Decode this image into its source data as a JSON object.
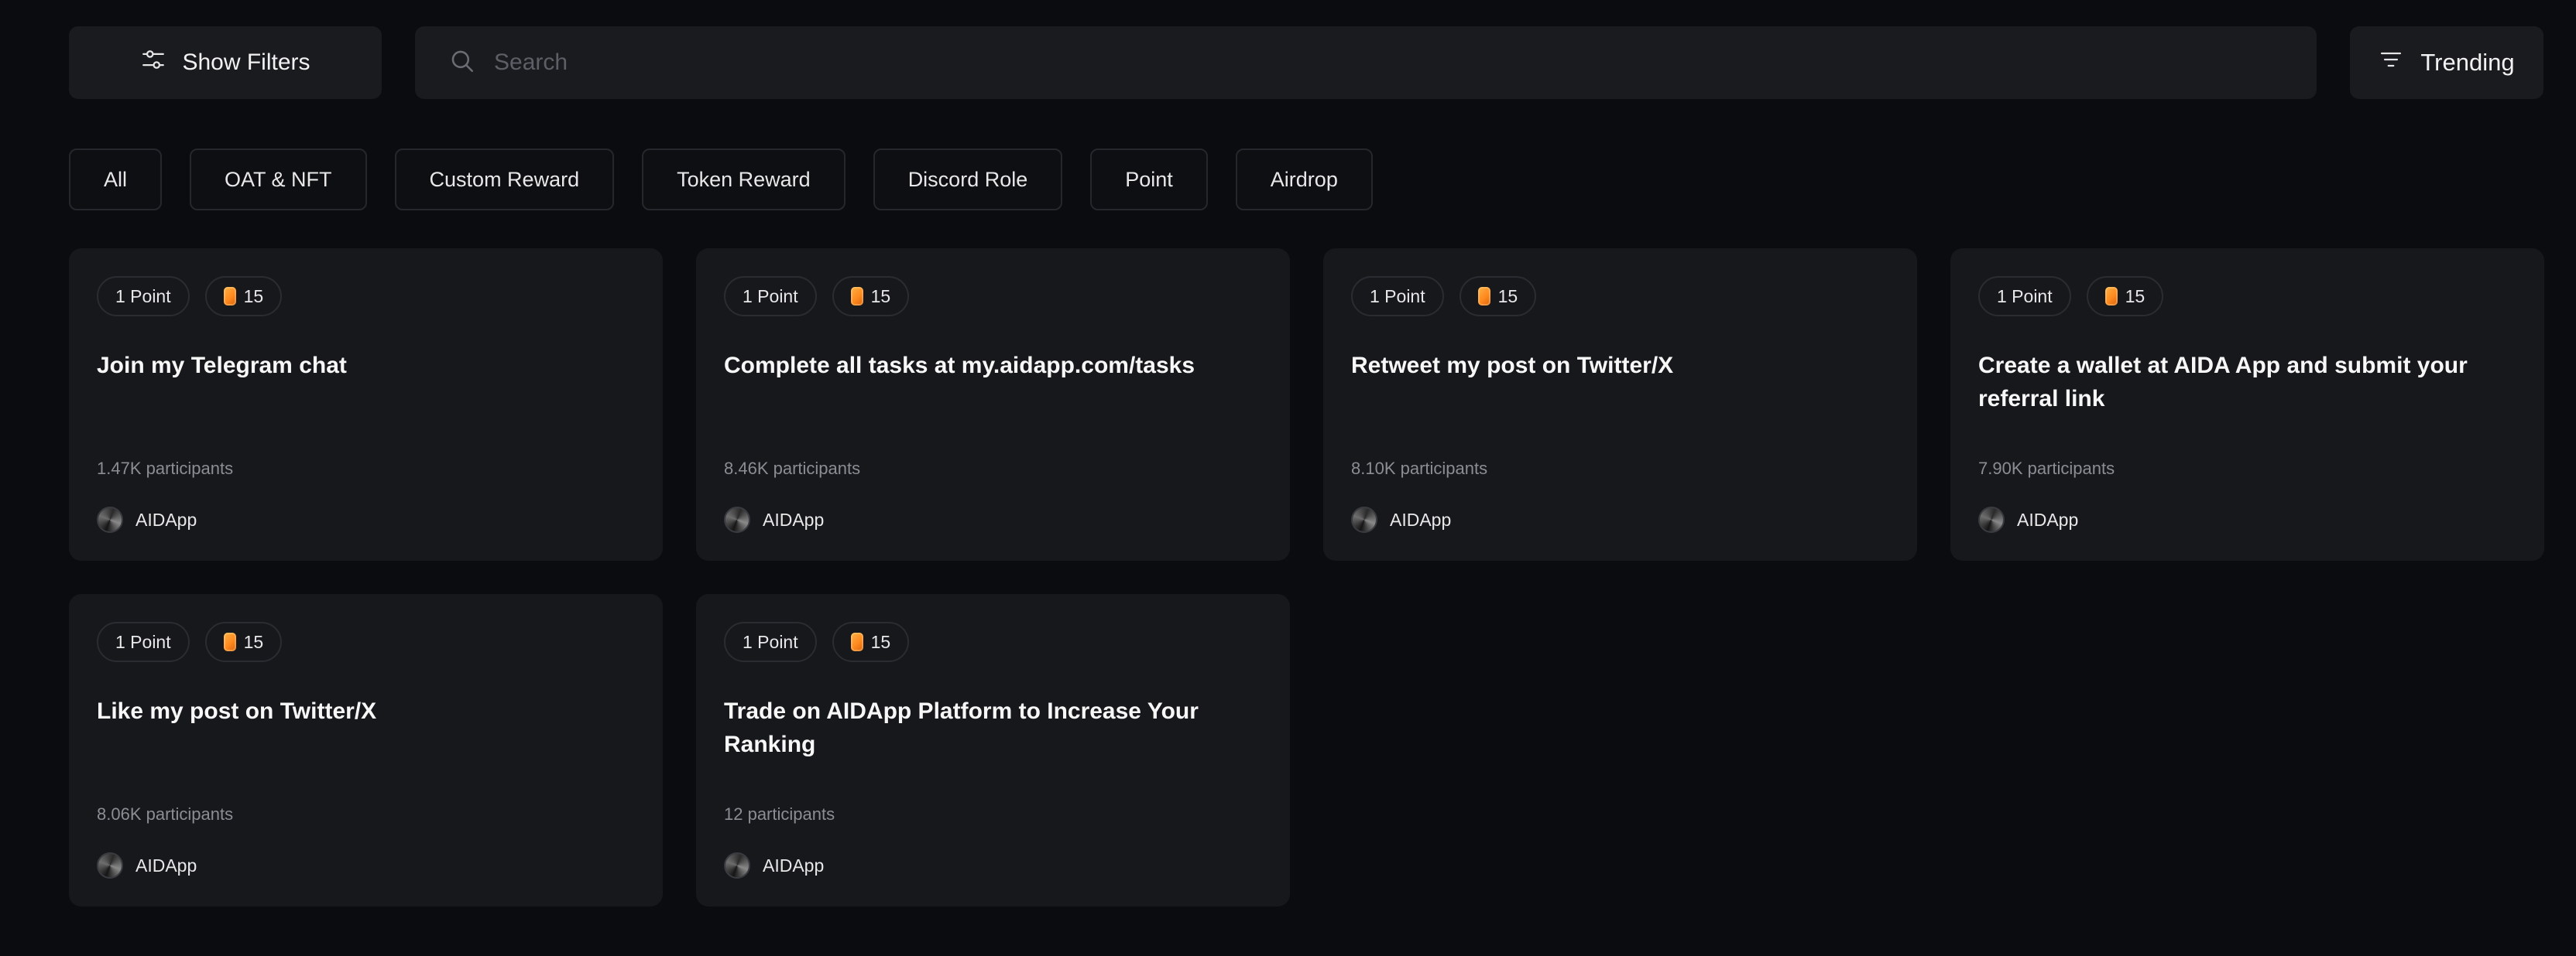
{
  "toolbar": {
    "filters_label": "Show Filters",
    "search_placeholder": "Search",
    "sort_label": "Trending"
  },
  "categories": [
    "All",
    "OAT & NFT",
    "Custom Reward",
    "Token Reward",
    "Discord Role",
    "Point",
    "Airdrop"
  ],
  "cards": [
    {
      "points": "1 Point",
      "reward": "15",
      "title": "Join my Telegram chat",
      "participants": "1.47K participants",
      "author": "AIDApp"
    },
    {
      "points": "1 Point",
      "reward": "15",
      "title": "Complete all tasks at my.aidapp.com/tasks",
      "participants": "8.46K participants",
      "author": "AIDApp"
    },
    {
      "points": "1 Point",
      "reward": "15",
      "title": "Retweet my post on Twitter/X",
      "participants": "8.10K participants",
      "author": "AIDApp"
    },
    {
      "points": "1 Point",
      "reward": "15",
      "title": "Create a wallet at AIDA App and submit your referral link",
      "participants": "7.90K participants",
      "author": "AIDApp"
    },
    {
      "points": "1 Point",
      "reward": "15",
      "title": "Like my post on Twitter/X",
      "participants": "8.06K participants",
      "author": "AIDApp"
    },
    {
      "points": "1 Point",
      "reward": "15",
      "title": "Trade on AIDApp Platform to Increase Your Ranking",
      "participants": "12 participants",
      "author": "AIDApp"
    }
  ],
  "icons": {
    "filters": "sliders-icon",
    "search": "search-icon",
    "sort": "sort-lines-icon",
    "reward": "coin-icon",
    "author": "avatar"
  },
  "colors": {
    "background": "#0b0c10",
    "surface": "#17181c",
    "accent_coin": "#ff8a1f"
  }
}
